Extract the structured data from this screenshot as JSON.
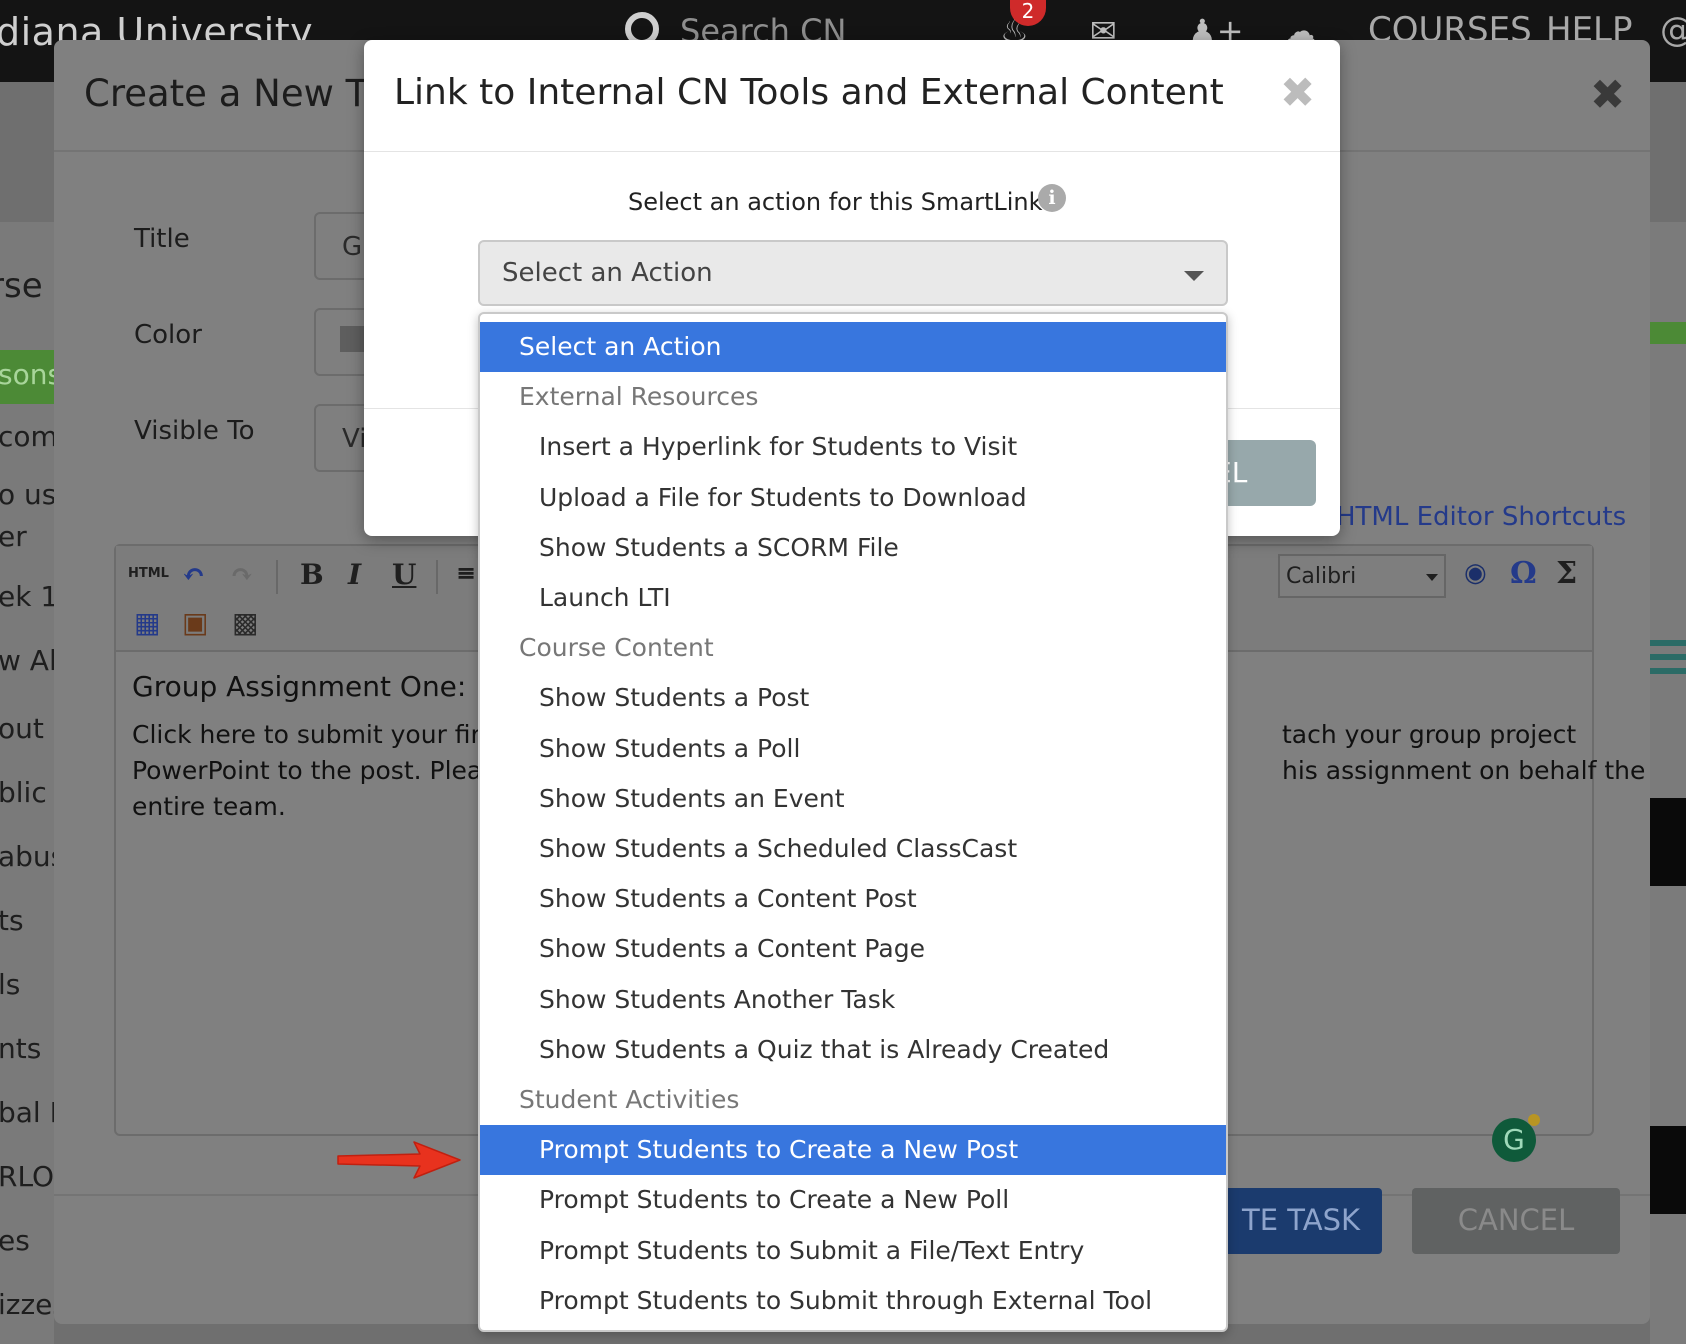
{
  "topbar": {
    "brand": "diana University",
    "search_placeholder": "Search CN",
    "notification_count": "2",
    "nav": [
      "COURSES",
      "HELP",
      "@"
    ],
    "icons": [
      "bell-icon",
      "mail-icon",
      "add-user-icon",
      "chat-icon"
    ]
  },
  "sidebar": {
    "header": "rse",
    "items": [
      "sons",
      "come",
      "o us k",
      "er",
      "ek 1",
      "w All",
      "out",
      "blic P",
      "abus",
      "ts",
      "ls",
      "nts",
      "bal I",
      "RLO",
      "es",
      "izzes"
    ]
  },
  "task_modal": {
    "title": "Create a New Tas",
    "labels": {
      "title": "Title",
      "color": "Color",
      "visible_to": "Visible To"
    },
    "values": {
      "title": "Gr",
      "visible_to": "Vi"
    },
    "editor_shortcuts": "HTML Editor Shortcuts",
    "toolbar": {
      "html": "HTML",
      "bold": "B",
      "italic": "I",
      "underline": "U",
      "font": "Calibri"
    },
    "editor": {
      "heading": "Group Assignment One:",
      "line1_left": "Click here to submit your first g",
      "line1_right": "tach your group project",
      "line2_left": "PowerPoint to the post. Please",
      "line2_right": "his assignment on behalf the",
      "line3": "entire team."
    },
    "create_button": "TE TASK",
    "cancel_button": "CANCEL"
  },
  "link_modal": {
    "title": "Link to Internal CN Tools and External Content",
    "prompt": "Select an action for this SmartLink:",
    "select_value": "Select an Action",
    "footer_button": "EL"
  },
  "dropdown": {
    "options": [
      {
        "label": "Select an Action",
        "kind": "top",
        "selected": true
      },
      {
        "label": "External Resources",
        "kind": "group"
      },
      {
        "label": "Insert a Hyperlink for Students to Visit",
        "kind": "child"
      },
      {
        "label": "Upload a File for Students to Download",
        "kind": "child"
      },
      {
        "label": "Show Students a SCORM File",
        "kind": "child"
      },
      {
        "label": "Launch LTI",
        "kind": "child"
      },
      {
        "label": "Course Content",
        "kind": "group"
      },
      {
        "label": "Show Students a Post",
        "kind": "child"
      },
      {
        "label": "Show Students a Poll",
        "kind": "child"
      },
      {
        "label": "Show Students an Event",
        "kind": "child"
      },
      {
        "label": "Show Students a Scheduled ClassCast",
        "kind": "child"
      },
      {
        "label": "Show Students a Content Post",
        "kind": "child"
      },
      {
        "label": "Show Students a Content Page",
        "kind": "child"
      },
      {
        "label": "Show Students Another Task",
        "kind": "child"
      },
      {
        "label": "Show Students a Quiz that is Already Created",
        "kind": "child"
      },
      {
        "label": "Student Activities",
        "kind": "group"
      },
      {
        "label": "Prompt Students to Create a New Post",
        "kind": "child",
        "selected": true
      },
      {
        "label": "Prompt Students to Create a New Poll",
        "kind": "child"
      },
      {
        "label": "Prompt Students to Submit a File/Text Entry",
        "kind": "child"
      },
      {
        "label": "Prompt Students to Submit through External Tool",
        "kind": "child"
      }
    ]
  },
  "colors": {
    "highlight": "#3876de",
    "annotation_arrow": "#e8321e",
    "create_button": "#1b3b6e"
  }
}
